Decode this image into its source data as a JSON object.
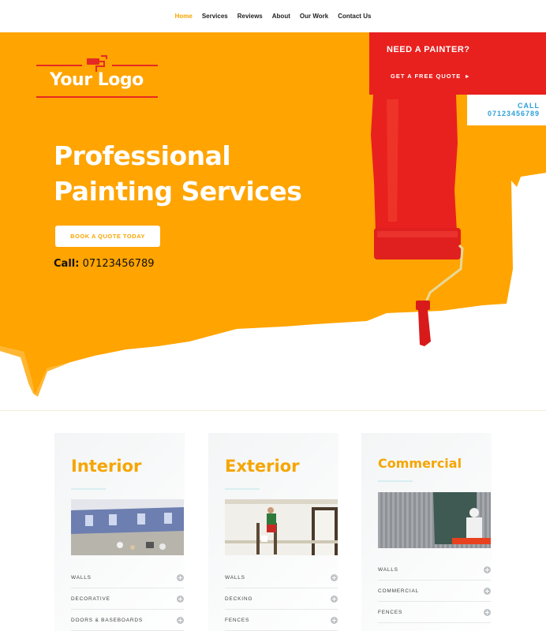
{
  "nav": {
    "items": [
      {
        "label": "Home",
        "active": true
      },
      {
        "label": "Services",
        "active": false
      },
      {
        "label": "Reviews",
        "active": false
      },
      {
        "label": "About",
        "active": false
      },
      {
        "label": "Our Work",
        "active": false
      },
      {
        "label": "Contact Us",
        "active": false
      }
    ]
  },
  "logo": {
    "text": "Your Logo",
    "icon": "paint-roller-icon"
  },
  "cta": {
    "title": "NEED A PAINTER?",
    "link": "GET A FREE QUOTE",
    "link_icon": "caret-right-icon"
  },
  "call_box": {
    "line1": "CALL",
    "line2": "07123456789"
  },
  "hero": {
    "headline_line1": "Professional",
    "headline_bold": "Painting",
    "headline_rest": " Services",
    "button": "BOOK A QUOTE TODAY",
    "call_label": "Call:",
    "call_number": " 07123456789"
  },
  "colors": {
    "accent": "#f6a500",
    "red": "#e8211f",
    "blue": "#2b9fd8"
  },
  "cards": [
    {
      "title": "Interior",
      "image": "room-painting-photo",
      "items": [
        "WALLS",
        "DECORATIVE",
        "DOORS & BASEBOARDS"
      ]
    },
    {
      "title": "Exterior",
      "image": "painter-on-ladder-photo",
      "items": [
        "WALLS",
        "DECKING",
        "FENCES"
      ]
    },
    {
      "title": "Commercial",
      "image": "spray-painting-photo",
      "items": [
        "WALLS",
        "COMMERCIAL",
        "FENCES"
      ]
    }
  ]
}
